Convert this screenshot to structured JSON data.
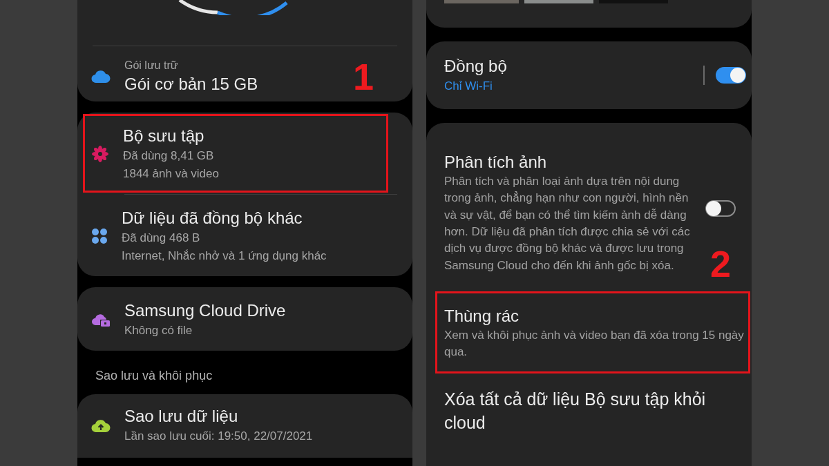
{
  "left": {
    "plan": {
      "label": "Gói lưu trữ",
      "value": "Gói cơ bản 15 GB",
      "step": "1"
    },
    "groups": [
      {
        "rows": [
          {
            "kind": "flower",
            "title": "Bộ sưu tập",
            "lines": [
              "Đã dùng 8,41 GB",
              "1844 ảnh và video"
            ],
            "highlighted": true
          },
          {
            "kind": "dots",
            "title": "Dữ liệu đã đồng bộ khác",
            "lines": [
              "Đã dùng 468 B",
              "Internet, Nhắc nhở và 1 ứng dụng khác"
            ],
            "highlighted": false
          }
        ]
      },
      {
        "rows": [
          {
            "kind": "cloud-folder",
            "title": "Samsung Cloud Drive",
            "lines": [
              "Không có file"
            ],
            "highlighted": false
          }
        ]
      }
    ],
    "section_header": "Sao lưu và khôi phục",
    "backup": {
      "kind": "upload",
      "title": "Sao lưu dữ liệu",
      "lines": [
        "Lần sao lưu cuối: 19:50, 22/07/2021"
      ]
    }
  },
  "right": {
    "sync": {
      "title": "Đồng bộ",
      "subtitle": "Chỉ Wi-Fi",
      "on": true
    },
    "settings": [
      {
        "kind": "toggle",
        "title": "Phân tích ảnh",
        "description": "Phân tích và phân loại ảnh dựa trên nội dung trong ảnh, chẳng hạn như con người, hình nền và sự vật, để bạn có thể tìm kiếm ảnh dễ dàng hơn. Dữ liệu đã phân tích được chia sẻ với các dịch vụ được đồng bộ khác và được lưu trong Samsung Cloud cho đến khi ảnh gốc bị xóa.",
        "on": false,
        "highlighted": false,
        "step": "2"
      },
      {
        "kind": "link",
        "title": "Thùng rác",
        "description": "Xem và khôi phục ảnh và video bạn đã xóa trong 15 ngày qua.",
        "highlighted": true
      },
      {
        "kind": "link",
        "title": "Xóa tất cả dữ liệu Bộ sưu tập khỏi cloud",
        "highlighted": false
      }
    ]
  }
}
